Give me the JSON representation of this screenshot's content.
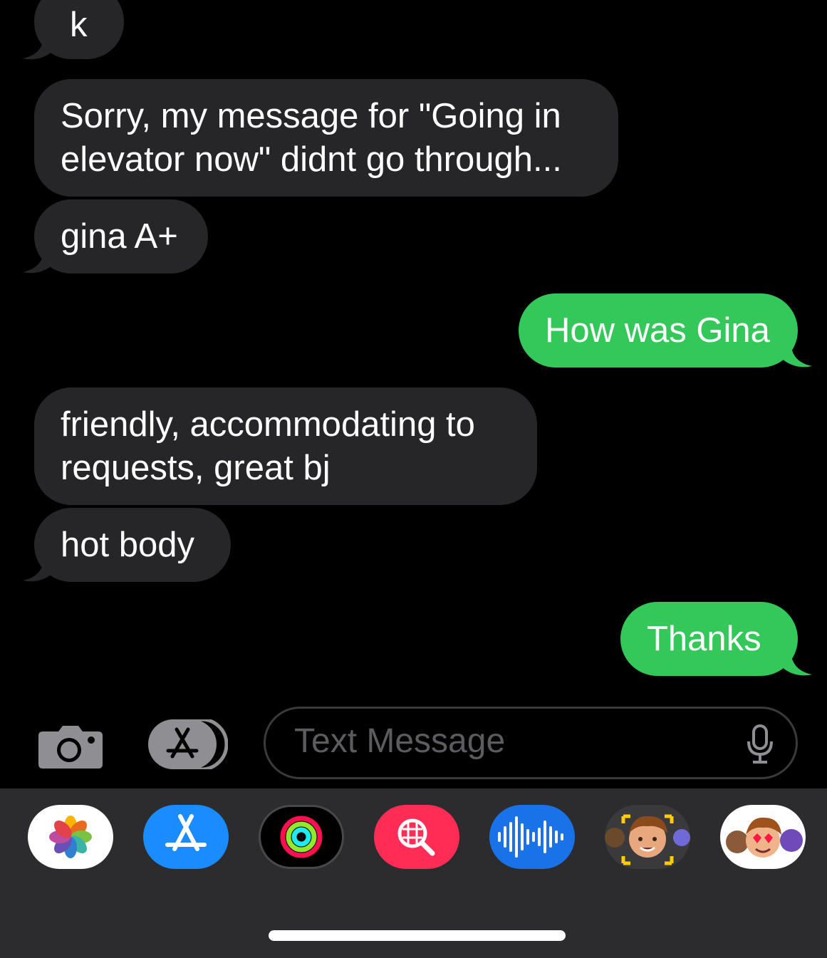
{
  "messages": {
    "m1": "k",
    "m2": "Sorry, my message for \"Going in\nelevator now\" didnt go through...",
    "m3": "gina A+",
    "m4": "How was Gina",
    "m5": "friendly, accommodating to\nrequests, great bj",
    "m6": "hot body",
    "m7": "Thanks"
  },
  "input": {
    "placeholder": "Text Message"
  },
  "colors": {
    "incoming_bubble": "#262628",
    "outgoing_bubble": "#34c759",
    "background": "#000000",
    "drawer": "#2c2c2e"
  },
  "app_drawer": [
    {
      "icon": "photos-icon"
    },
    {
      "icon": "app-store-icon"
    },
    {
      "icon": "activity-icon"
    },
    {
      "icon": "images-search-icon"
    },
    {
      "icon": "audio-message-icon"
    },
    {
      "icon": "memoji-icon"
    },
    {
      "icon": "memoji-stickers-icon"
    }
  ]
}
